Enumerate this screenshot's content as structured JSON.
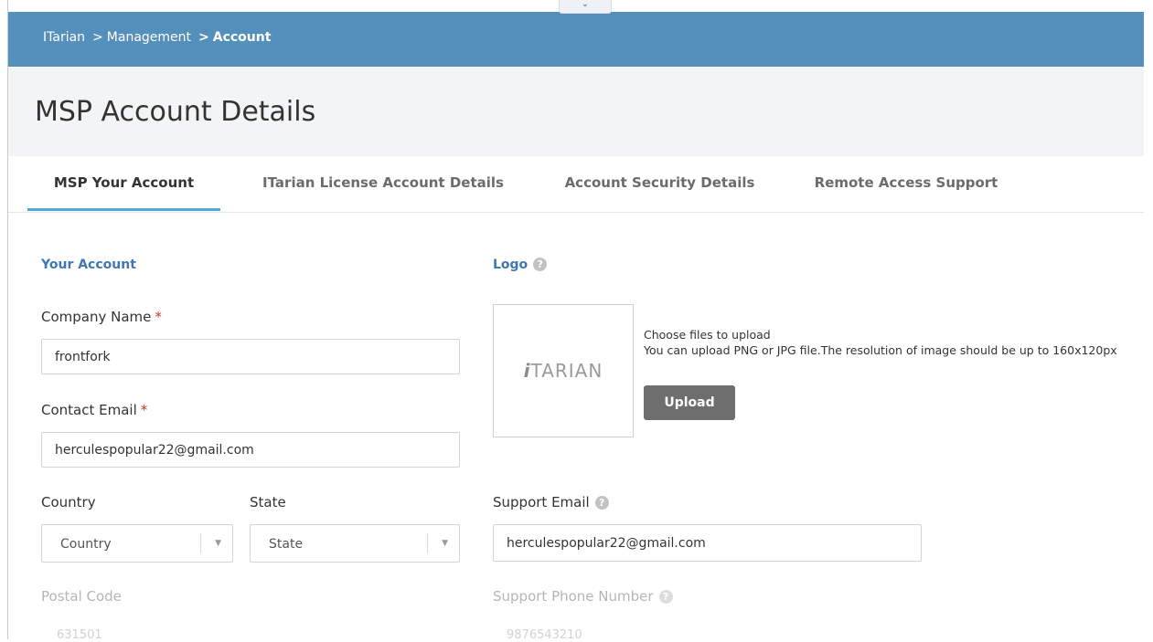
{
  "breadcrumb": {
    "root": "ITarian",
    "sep1": ">",
    "middle": "Management",
    "sep2": ">",
    "current": "Account"
  },
  "collapse_icon": "chevron-down-icon",
  "page": {
    "title": "MSP Account Details"
  },
  "tabs": [
    {
      "label": "MSP Your Account",
      "active": true
    },
    {
      "label": "ITarian License Account Details",
      "active": false
    },
    {
      "label": "Account Security Details",
      "active": false
    },
    {
      "label": "Remote Access Support",
      "active": false
    }
  ],
  "your_account": {
    "section_title": "Your Account",
    "company_name": {
      "label": "Company Name",
      "required_mark": "*",
      "value": "frontfork"
    },
    "contact_email": {
      "label": "Contact Email",
      "required_mark": "*",
      "value": "herculespopular22@gmail.com"
    },
    "country": {
      "label": "Country",
      "value": "Country"
    },
    "state": {
      "label": "State",
      "value": "State"
    },
    "postal_code": {
      "label": "Postal Code",
      "value": "631501"
    }
  },
  "logo": {
    "section_title": "Logo",
    "help_icon": "question-circle-icon",
    "image_text_mark": "i",
    "image_text": "TARIAN",
    "hint_title": "Choose files to upload",
    "hint_text": "You can upload PNG or JPG file.The resolution of image should be up to 160x120px",
    "upload_label": "Upload"
  },
  "support": {
    "email": {
      "label": "Support Email",
      "value": "herculespopular22@gmail.com"
    },
    "phone": {
      "label": "Support Phone Number",
      "value": "9876543210"
    }
  },
  "colors": {
    "header": "#5590bd",
    "accent": "#48a9dc",
    "required": "#d9312b",
    "section_title": "#3f78b0",
    "upload_button": "#6e6e6e"
  }
}
